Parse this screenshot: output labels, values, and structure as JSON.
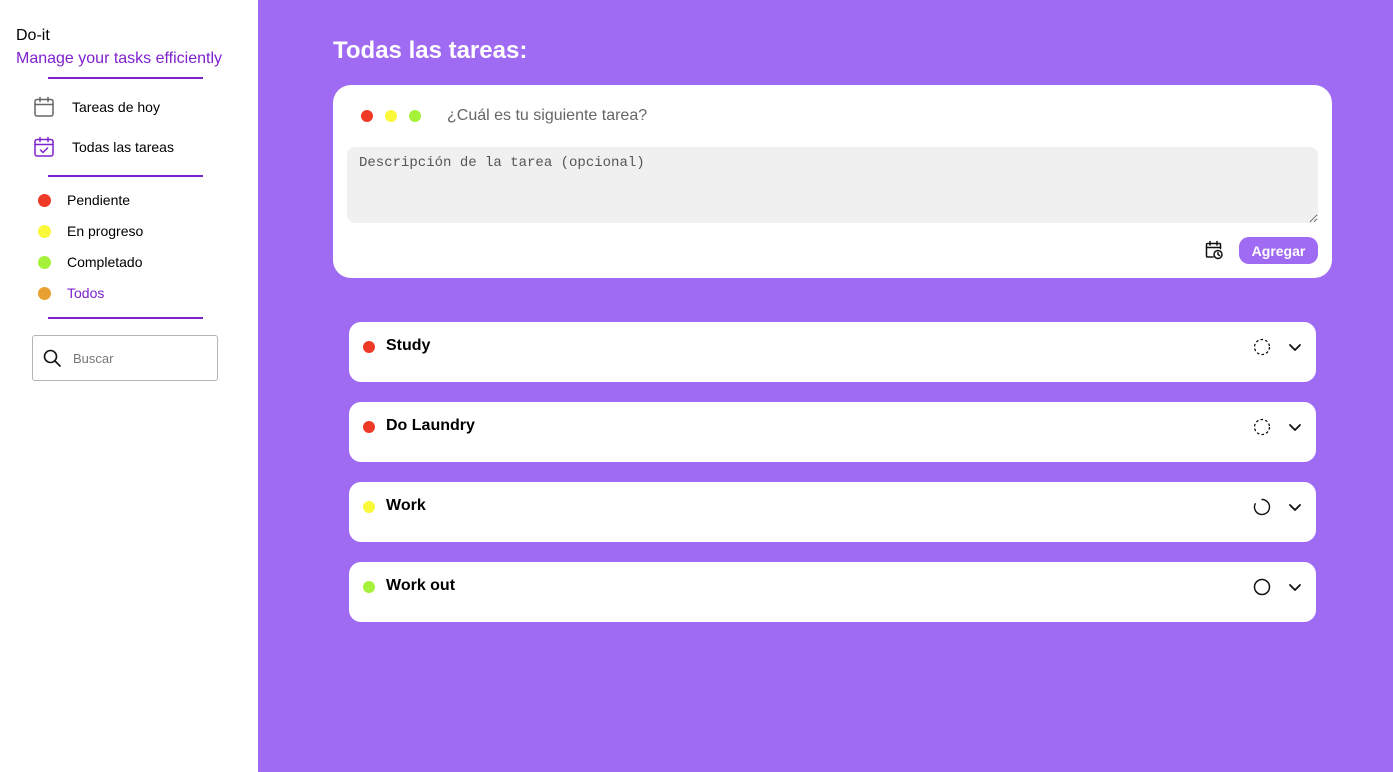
{
  "app": {
    "title": "Do-it",
    "subtitle": "Manage your tasks efficiently"
  },
  "sidebar": {
    "nav": [
      {
        "label": "Tareas de hoy",
        "icon": "calendar-icon"
      },
      {
        "label": "Todas las tareas",
        "icon": "calendar-check-icon",
        "active": true
      }
    ],
    "filters": [
      {
        "label": "Pendiente",
        "color": "#ee3a26"
      },
      {
        "label": "En progreso",
        "color": "#f9f93a"
      },
      {
        "label": "Completado",
        "color": "#a6f23a"
      },
      {
        "label": "Todos",
        "color": "#e8a030",
        "active": true
      }
    ],
    "search": {
      "placeholder": "Buscar",
      "icon": "search-icon"
    }
  },
  "main": {
    "title": "Todas las tareas:",
    "composer": {
      "status_colors": [
        "#ee3a26",
        "#f9f93a",
        "#a6f23a"
      ],
      "title_placeholder": "¿Cuál es tu siguiente tarea?",
      "description_placeholder": "Descripción de la tarea (opcional)",
      "date_icon": "calendar-clock-icon",
      "add_label": "Agregar"
    },
    "tasks": [
      {
        "title": "Study",
        "color": "#ee3a26",
        "status_icon": "pending-icon"
      },
      {
        "title": "Do Laundry",
        "color": "#ee3a26",
        "status_icon": "pending-icon"
      },
      {
        "title": "Work",
        "color": "#f9f93a",
        "status_icon": "in-progress-icon"
      },
      {
        "title": "Work out",
        "color": "#a6f23a",
        "status_icon": "completed-icon"
      }
    ]
  },
  "colors": {
    "accent": "#a06bf3",
    "brand": "#7e22ce"
  }
}
